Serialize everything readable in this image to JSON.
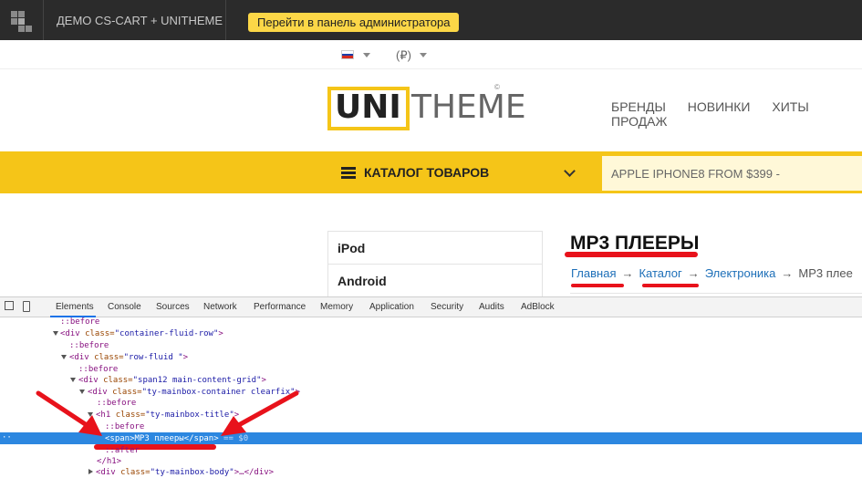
{
  "admin_bar": {
    "store_name": "ДЕМО CS-CART + UNITHEME",
    "admin_button": "Перейти в панель администратора"
  },
  "lang_row": {
    "currency": "(₽)"
  },
  "header": {
    "logo_bold": "UNI",
    "logo_light": "THEME",
    "logo_mark": "©",
    "nav": [
      "БРЕНДЫ",
      "НОВИНКИ",
      "ХИТЫ ПРОДАЖ"
    ]
  },
  "catalog_bar": {
    "label": "КАТАЛОГ ТОВАРОВ",
    "search_value": "APPLE IPHONE8 FROM $399 -"
  },
  "side_menu": [
    "iPod",
    "Android"
  ],
  "main": {
    "title": "MP3 ПЛЕЕРЫ",
    "breadcrumb": [
      "Главная",
      "Каталог",
      "Электроника",
      "MP3 плее"
    ],
    "breadcrumb_sep": "→"
  },
  "devtools": {
    "tabs": [
      "Elements",
      "Console",
      "Sources",
      "Network",
      "Performance",
      "Memory",
      "Application",
      "Security",
      "Audits",
      "AdBlock"
    ],
    "lines": {
      "l1": "::before",
      "l2_tag_open": "<div ",
      "l2_attr": "class=",
      "l2_val": "\"container-fluid-row\"",
      "l2_close": ">",
      "l3": "::before",
      "l4_tag_open": "<div ",
      "l4_attr": "class=",
      "l4_val": "\"row-fluid \"",
      "l4_close": ">",
      "l5": "::before",
      "l6_tag_open": "<div ",
      "l6_attr": "class=",
      "l6_val": "\"span12 main-content-grid\"",
      "l6_close": ">",
      "l7_tag_open": "<div ",
      "l7_attr": "class=",
      "l7_val": "\"ty-mainbox-container clearfix\"",
      "l7_close": ">",
      "l8": "::before",
      "l9_tag_open": "<h1 ",
      "l9_attr": "class=",
      "l9_val": "\"ty-mainbox-title\"",
      "l9_close": ">",
      "l10": "::before",
      "selected": "<span>MP3 плееры</span>",
      "selected_suffix": " == $0",
      "l12": "::after",
      "l13": "</h1>",
      "l14_tag_open": "<div ",
      "l14_attr": "class=",
      "l14_val": "\"ty-mainbox-body\"",
      "l14_close": ">…</div>"
    }
  },
  "colors": {
    "accent_yellow": "#f5c518",
    "annotation_red": "#e8121b",
    "devtools_selection": "#2c87e0"
  }
}
